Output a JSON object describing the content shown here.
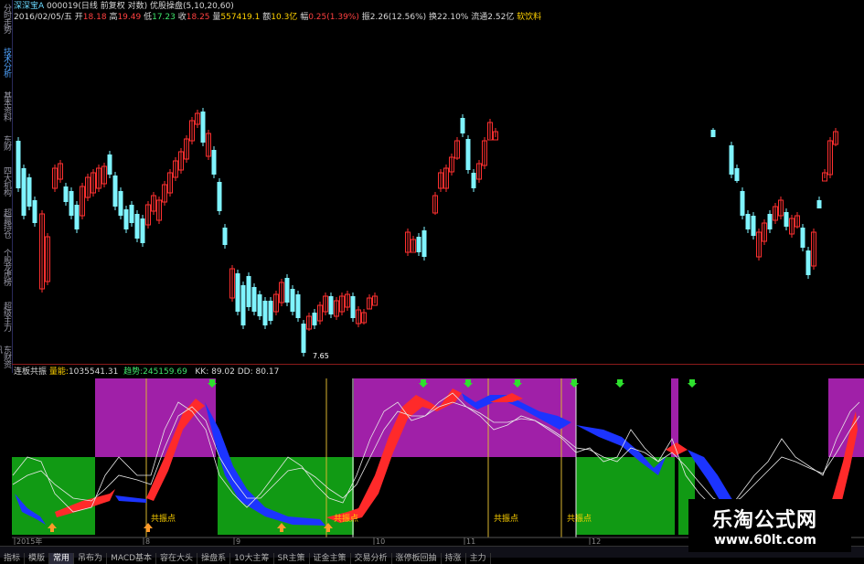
{
  "header": {
    "stock": "深深宝A",
    "code": "000019",
    "mode": "(日线 前复权 对数)",
    "indicator": "优股操盘(5,10,20,60)"
  },
  "quote": {
    "date": "2016/02/05/五",
    "open_label": "开",
    "open": "18.18",
    "high_label": "高",
    "high": "19.49",
    "low_label": "低",
    "low": "17.23",
    "close_label": "收",
    "close": "18.25",
    "vol_label": "量",
    "vol": "557419.1",
    "amount_label": "额",
    "amount": "10.3亿",
    "change_label": "幅",
    "change": "0.25(1.39%)",
    "amplitude_label": "振",
    "amplitude": "2.26(12.56%)",
    "turnover_label": "换",
    "turnover": "22.10%",
    "float_label": "流通",
    "float": "2.52亿",
    "sector": "软饮料"
  },
  "side_tabs": [
    {
      "label": "分时走势",
      "active": false
    },
    {
      "label": "技术分析",
      "active": true
    },
    {
      "label": "基本资料",
      "active": false
    },
    {
      "label": "东财",
      "active": false
    },
    {
      "label": "四大机构",
      "active": false
    },
    {
      "label": "超赢持仓",
      "active": false
    },
    {
      "label": "个股龙虎榜",
      "active": false
    },
    {
      "label": "超级主力",
      "active": false
    },
    {
      "label": "东财资讯",
      "active": false
    }
  ],
  "price_low_label": "7.65",
  "indicator_panel": {
    "name": "连板共振",
    "vol_label": "量能:",
    "vol_value": "1035541.31",
    "flow_label": "趋势:",
    "flow_value": "245159.69",
    "kk_label": "KK:",
    "kk_value": "89.02",
    "dd_label": "DD:",
    "dd_value": "80.17",
    "resonance_label": "共振点"
  },
  "axis_labels": [
    "2015年",
    "8",
    "9",
    "10",
    "11",
    "12"
  ],
  "bottom_tabs": [
    {
      "label": "指标",
      "active": false
    },
    {
      "label": "模版",
      "active": false
    },
    {
      "label": "常用",
      "active": true
    },
    {
      "label": "吊布为",
      "active": false
    },
    {
      "label": "MACD基本",
      "active": false
    },
    {
      "label": "容在大头",
      "active": false
    },
    {
      "label": "操盘系",
      "active": false
    },
    {
      "label": "10大主筹",
      "active": false
    },
    {
      "label": "SR主策",
      "active": false
    },
    {
      "label": "证金主策",
      "active": false
    },
    {
      "label": "交易分析",
      "active": false
    },
    {
      "label": "涨停板回抽",
      "active": false
    },
    {
      "label": "持涨",
      "active": false
    },
    {
      "label": "主力",
      "active": false
    }
  ],
  "watermark": {
    "title": "乐淘公式网",
    "url": "www.60lt.com"
  },
  "colors": {
    "up": "#ff3030",
    "down": "#7ff4ff",
    "purple_zone": "#a020a8",
    "green_zone": "#119a14",
    "band_up": "#ff2a2a",
    "band_down": "#1c34ff",
    "vline": "#d8b430"
  }
}
